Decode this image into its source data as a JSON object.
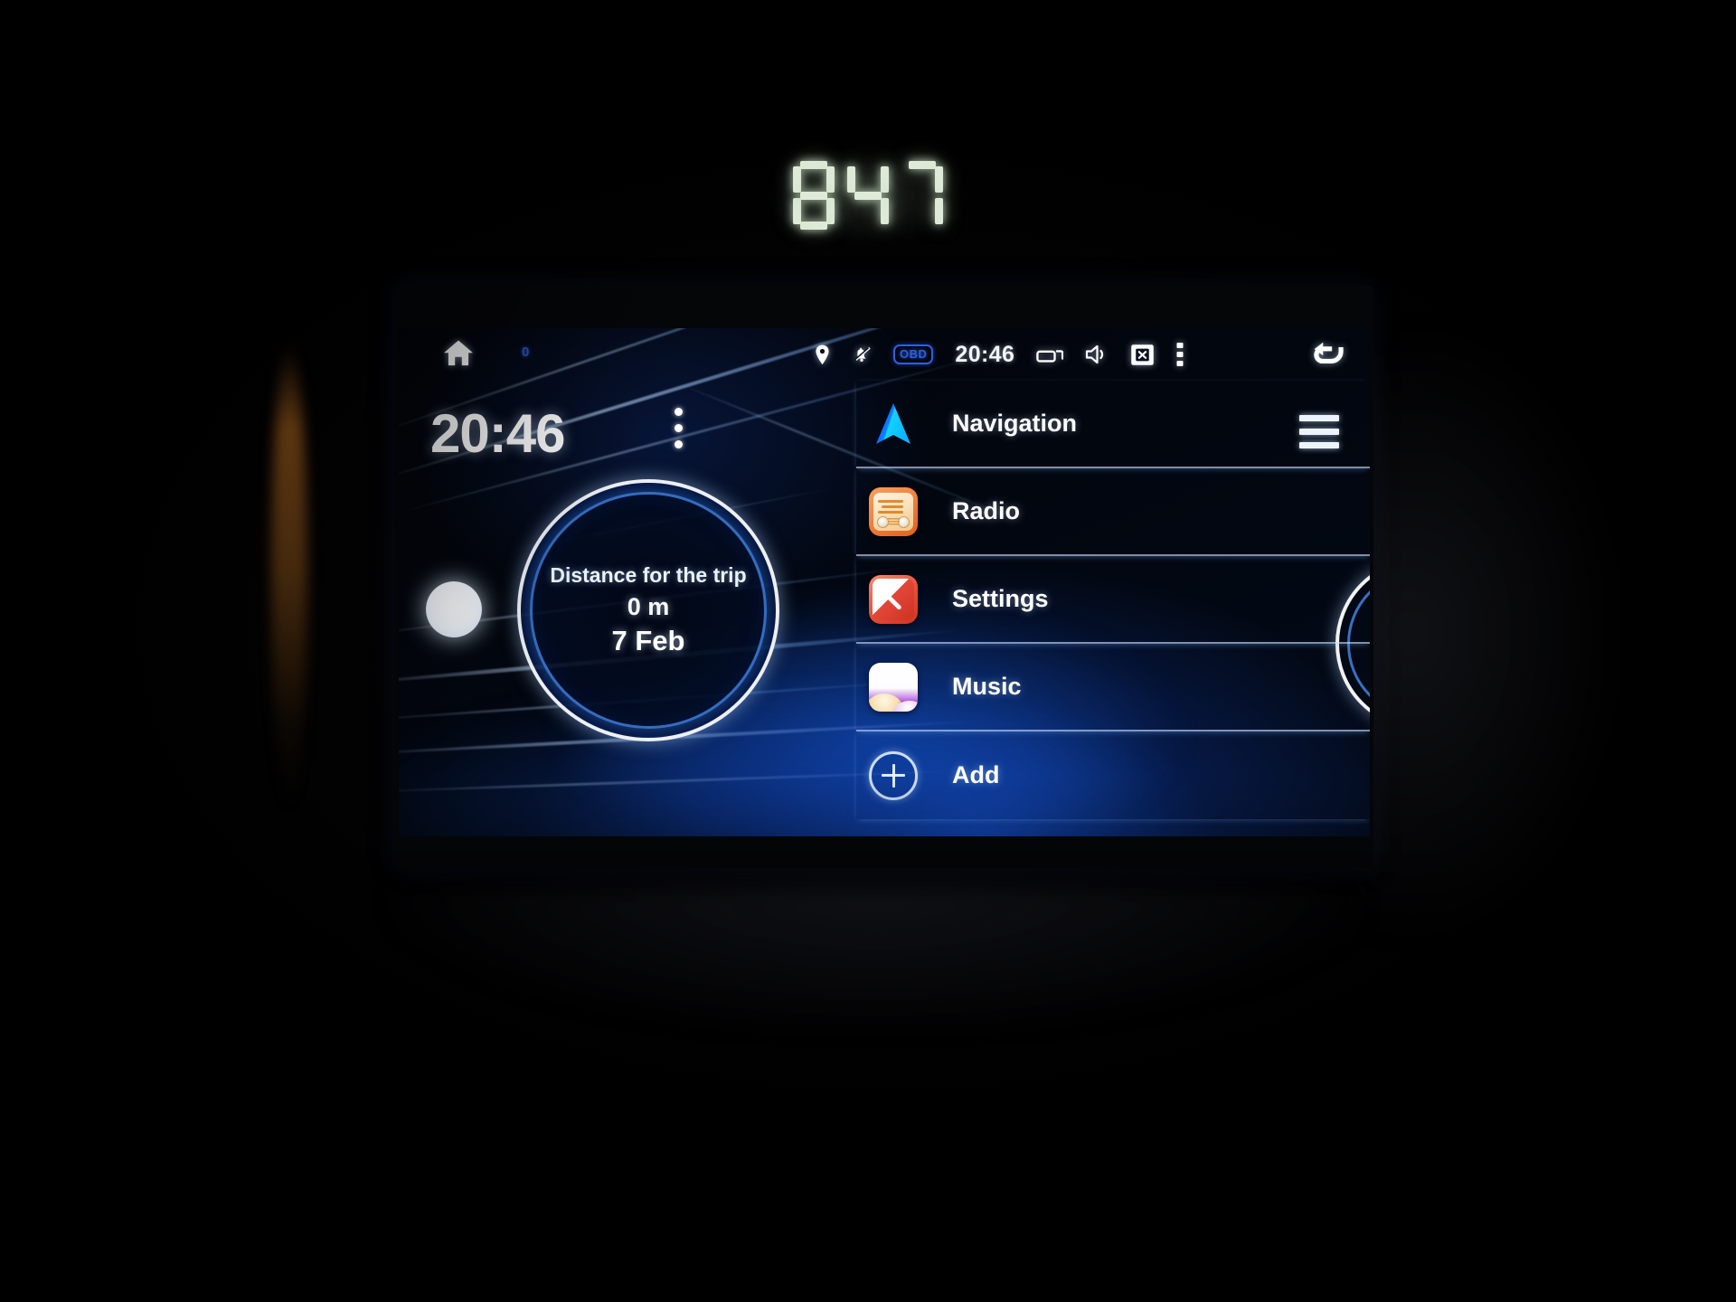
{
  "device": {
    "dash_clock": {
      "name": "dashboard-7segment-clock",
      "value": "847",
      "digits": [
        "8",
        "4",
        "7"
      ]
    }
  },
  "statusbar": {
    "home_icon": "home-icon",
    "notification_count": "0",
    "location_icon": "location-pin-icon",
    "mute_icon": "bell-muted-icon",
    "obd_badge": "OBD",
    "time": "20:46",
    "recents_icon": "recents-icon",
    "volume_icon": "volume-icon",
    "close_icon": "close-box-icon",
    "overflow_icon": "more-vertical-icon",
    "back_icon": "back-arrow-icon"
  },
  "home": {
    "clock": "20:46",
    "options_icon": "more-vertical-icon",
    "menu_icon": "hamburger-menu-icon",
    "trip_card": {
      "label": "Distance for the trip",
      "distance": "0 m",
      "date": "7 Feb"
    }
  },
  "apps": [
    {
      "label": "Navigation",
      "icon": "navigation-arrow-icon"
    },
    {
      "label": "Radio",
      "icon": "radio-icon"
    },
    {
      "label": "Settings",
      "icon": "settings-icon"
    },
    {
      "label": "Music",
      "icon": "music-icon"
    },
    {
      "label": "Add",
      "icon": "plus-circle-icon"
    }
  ],
  "colors": {
    "accent_blue": "#2f5fe0",
    "wallpaper_blue": "#124abe",
    "radio_orange": "#ef7b3b",
    "settings_red": "#e8503a",
    "music_purple": "#8733bd",
    "nav_cyan": "#1ab8ff",
    "text_white": "#ffffff",
    "segment_green": "#dfead9"
  }
}
